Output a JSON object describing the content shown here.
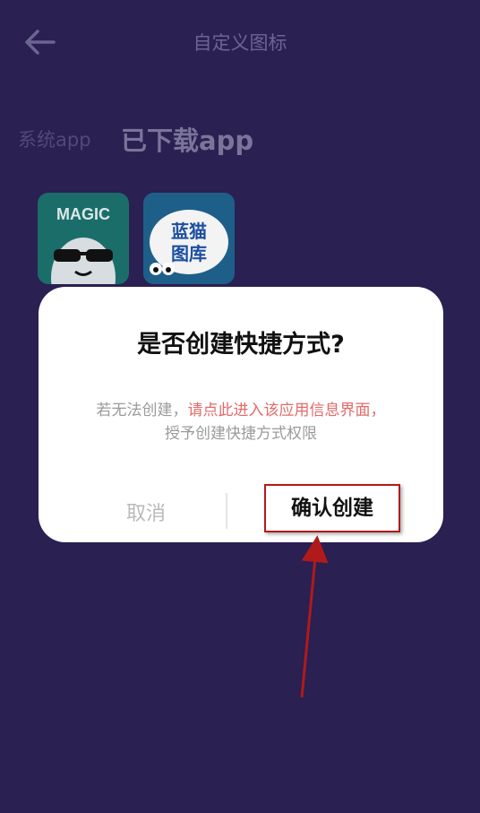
{
  "header": {
    "title": "自定义图标",
    "back_icon": "arrow-left-icon"
  },
  "tabs": {
    "system": "系统app",
    "downloaded": "已下载app"
  },
  "apps": [
    {
      "name": "MAGIC",
      "icon": "magic-app-icon"
    },
    {
      "name": "蓝猫图库",
      "icon": "lanmao-gallery-icon"
    }
  ],
  "dialog": {
    "title": "是否创建快捷方式?",
    "message_prefix": "若无法创建，",
    "message_link": "请点此进入该应用信息界面，",
    "message_suffix": "授予创建快捷方式权限",
    "cancel_label": "取消",
    "confirm_label": "确认创建"
  },
  "colors": {
    "background": "#2a2052",
    "link": "#e26a6a",
    "highlight_border": "#b11a1a"
  }
}
